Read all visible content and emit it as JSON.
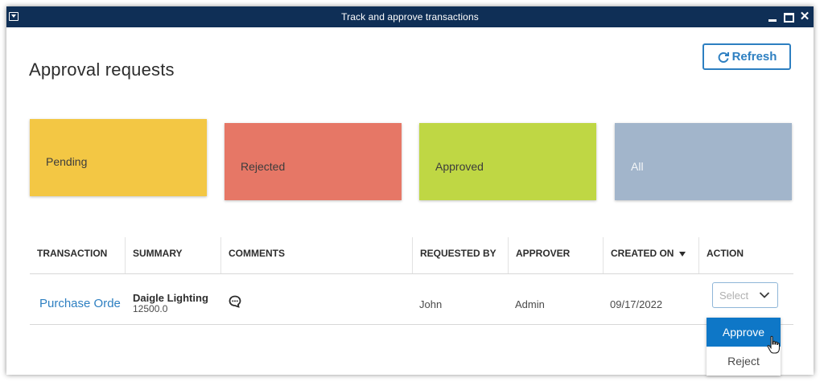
{
  "window": {
    "title": "Track and approve transactions",
    "titlebar_color": "#0f2f56",
    "controls": [
      "minimize-icon",
      "maximize-icon",
      "close-icon"
    ]
  },
  "page": {
    "title": "Approval requests",
    "refresh_label": "Refresh",
    "refresh_icon": "refresh-icon",
    "accent_color": "#2d7fc1"
  },
  "status_cards": [
    {
      "label": "Pending",
      "color": "#f3c744"
    },
    {
      "label": "Rejected",
      "color": "#e67766"
    },
    {
      "label": "Approved",
      "color": "#bfd744"
    },
    {
      "label": "All",
      "color": "#a2b5cb"
    }
  ],
  "table": {
    "columns": [
      "TRANSACTION",
      "SUMMARY",
      "COMMENTS",
      "REQUESTED BY",
      "APPROVER",
      "CREATED ON",
      "ACTION"
    ],
    "sorted_column": "CREATED ON",
    "sort_icon": "sort-down-icon",
    "rows": [
      {
        "transaction": "Purchase Orde",
        "summary_name": "Daigle Lighting",
        "summary_amount": "12500.0",
        "comment_icon": "comment-icon",
        "requested_by": "John",
        "approver": "Admin",
        "created_on": "09/17/2022",
        "action_placeholder": "Select"
      }
    ]
  },
  "action_menu": {
    "options": [
      "Approve",
      "Reject"
    ],
    "highlighted": "Approve",
    "highlight_color": "#0e77c7"
  }
}
